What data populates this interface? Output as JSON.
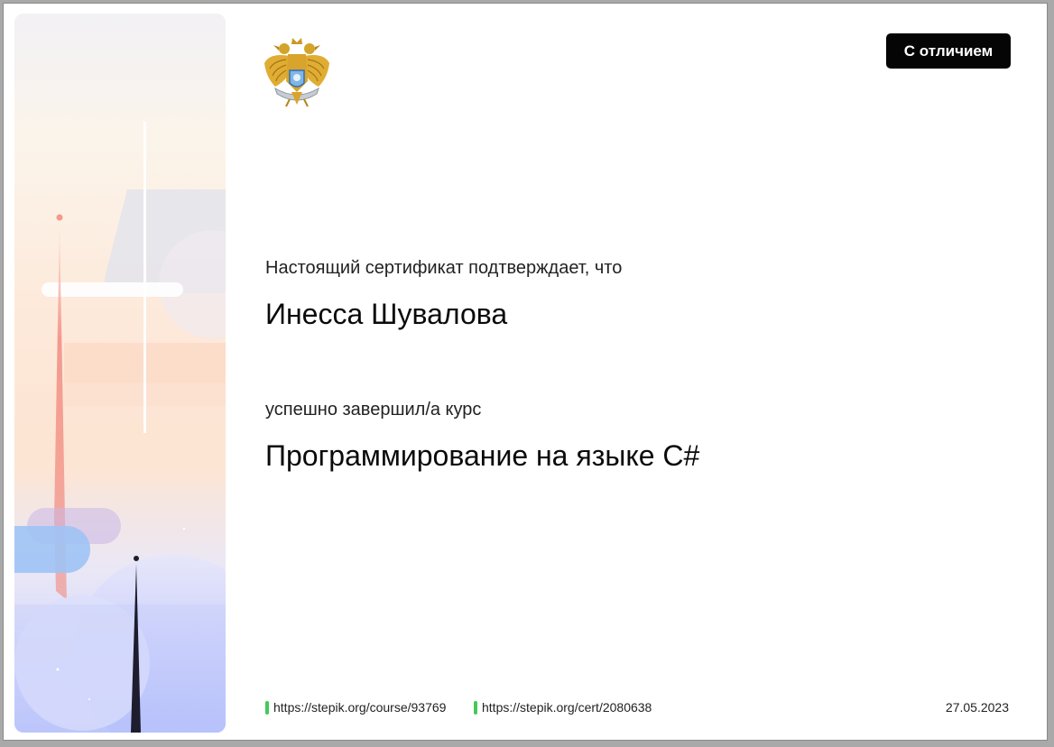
{
  "badge": {
    "label": "С отличием"
  },
  "certificate": {
    "intro": "Настоящий сертификат подтверждает, что",
    "recipient_name": "Инесса Шувалова",
    "completed_text": "успешно завершил/а  курс",
    "course_title": "Программирование на языке C#"
  },
  "footer": {
    "course_link": "https://stepik.org/course/93769",
    "cert_link": "https://stepik.org/cert/2080638",
    "date": "27.05.2023"
  },
  "colors": {
    "badge_bg": "#050505",
    "link_marker": "#44c85a"
  },
  "icons": {
    "emblem": "double-headed-eagle-emblem-icon"
  }
}
